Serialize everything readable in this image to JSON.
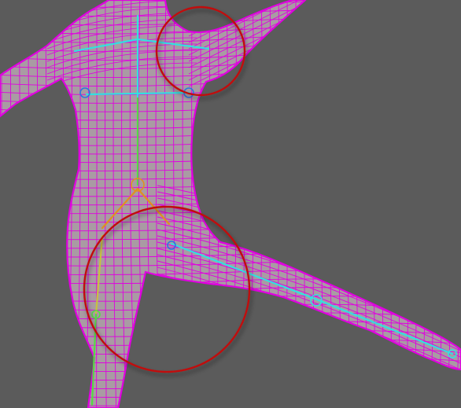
{
  "viewport": {
    "background": "#5b5b5b",
    "mesh_fill": "#a99ba3",
    "wire_color": "#e000e0",
    "skeleton_cyan": "#33e0e0",
    "skeleton_green": "#55d944",
    "skeleton_yellow": "#c8c040",
    "skeleton_orange": "#e09020",
    "highlight_circle_color": "#c01010"
  },
  "model": {
    "icon": "character-mesh-icon"
  },
  "annotations": [
    {
      "name": "shoulder-highlight-circle",
      "icon": "circle-outline-icon"
    },
    {
      "name": "hip-highlight-circle",
      "icon": "circle-outline-icon"
    }
  ]
}
